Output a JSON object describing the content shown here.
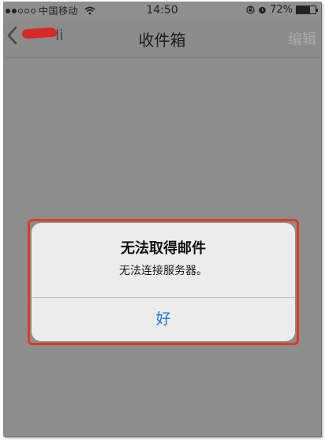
{
  "status_bar": {
    "carrier": "中国移动",
    "time": "14:50",
    "battery": "72%",
    "battery_level": 0.72,
    "signal_dots_filled": 2,
    "signal_dots_total": 5,
    "icons": [
      "wifi-icon",
      "orientation-lock-icon",
      "alarm-icon",
      "battery-icon"
    ]
  },
  "nav": {
    "back_label": "li",
    "title": "收件箱",
    "edit_label": "编辑"
  },
  "alert": {
    "title": "无法取得邮件",
    "message": "无法连接服务器。",
    "ok_label": "好"
  },
  "colors": {
    "background_dimmed": "#8d8d8d",
    "alert_bg": "#ececec",
    "button_blue": "#1a73d9",
    "highlight_red": "#e03a1e"
  }
}
